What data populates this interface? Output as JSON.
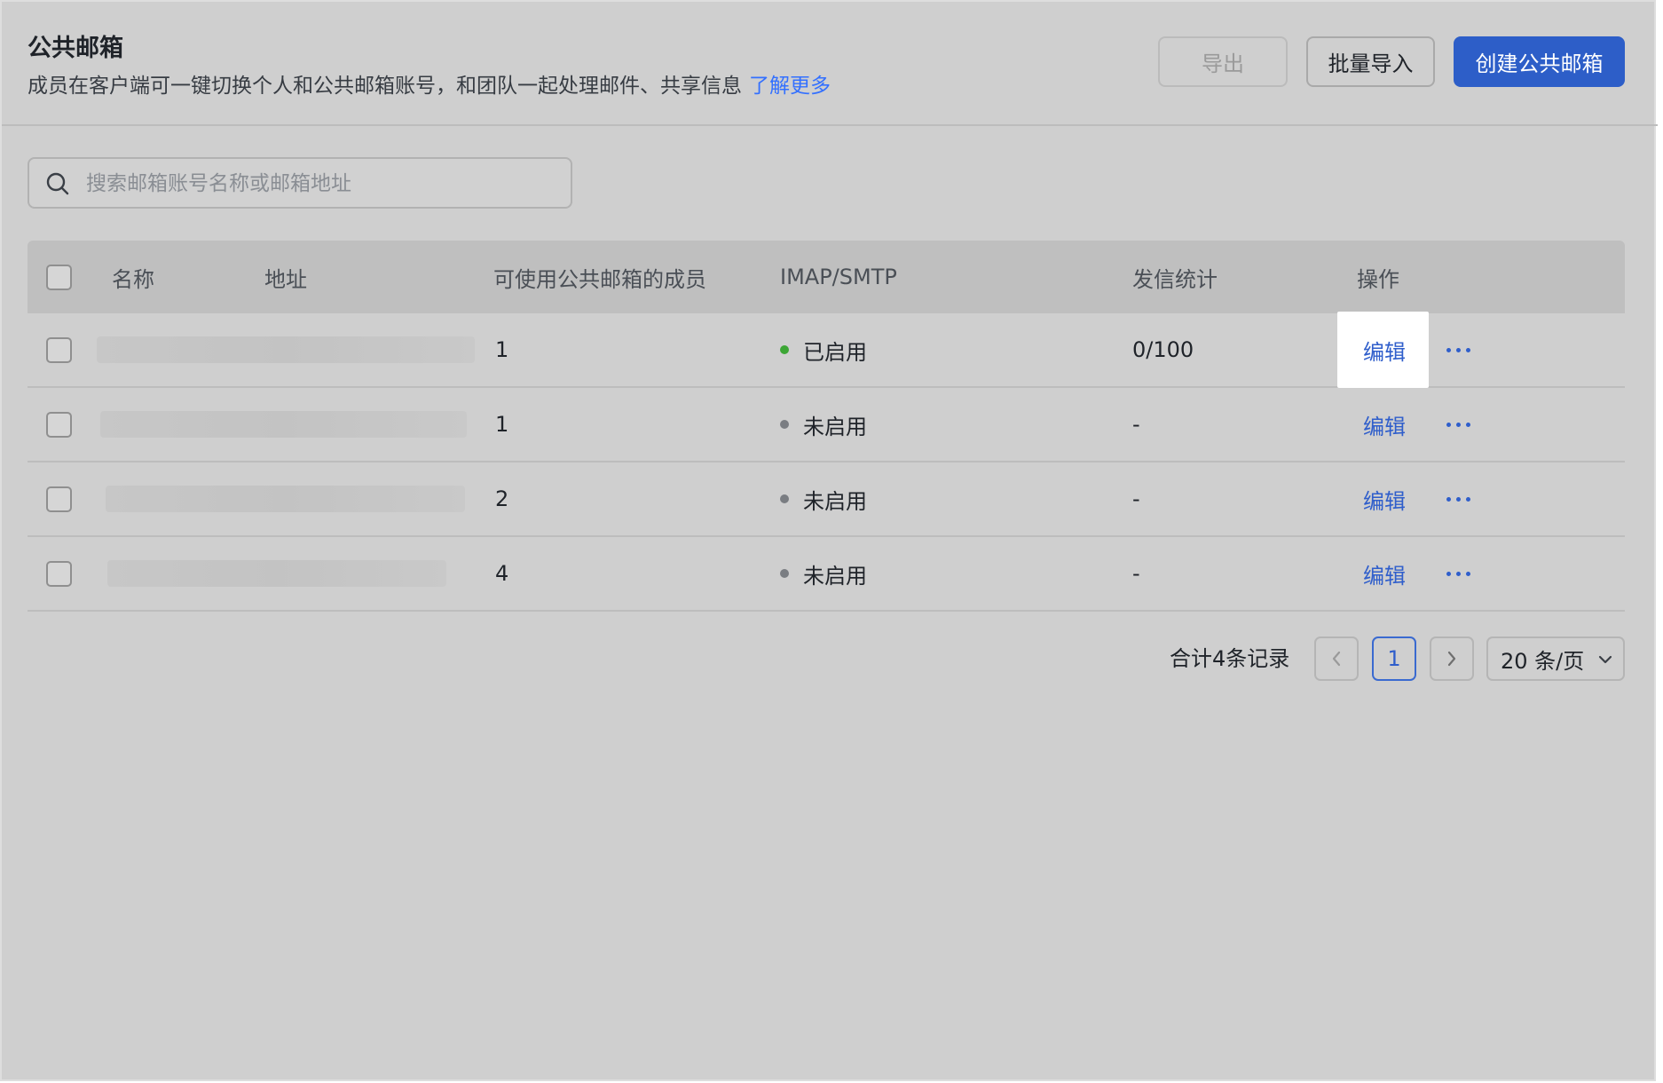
{
  "header": {
    "title": "公共邮箱",
    "description": "成员在客户端可一键切换个人和公共邮箱账号，和团队一起处理邮件、共享信息",
    "learn_more": "了解更多",
    "export_label": "导出",
    "import_label": "批量导入",
    "create_label": "创建公共邮箱"
  },
  "search": {
    "placeholder": "搜索邮箱账号名称或邮箱地址",
    "icon": "search-icon"
  },
  "table": {
    "columns": [
      "名称",
      "地址",
      "可使用公共邮箱的成员",
      "IMAP/SMTP",
      "发信统计",
      "操作"
    ],
    "rows": [
      {
        "members": "1",
        "imap_status": "已启用",
        "status_color": "#3ca635",
        "send_stats": "0/100",
        "edit_label": "编辑"
      },
      {
        "members": "1",
        "imap_status": "未启用",
        "status_color": "#7a7d82",
        "send_stats": "-",
        "edit_label": "编辑"
      },
      {
        "members": "2",
        "imap_status": "未启用",
        "status_color": "#7a7d82",
        "send_stats": "-",
        "edit_label": "编辑"
      },
      {
        "members": "4",
        "imap_status": "未启用",
        "status_color": "#7a7d82",
        "send_stats": "-",
        "edit_label": "编辑"
      }
    ]
  },
  "pagination": {
    "total_text": "合计4条记录",
    "current_page": "1",
    "page_size_label": "20 条/页"
  },
  "colors": {
    "accent": "#2d5ec8",
    "link": "#3370ff"
  }
}
